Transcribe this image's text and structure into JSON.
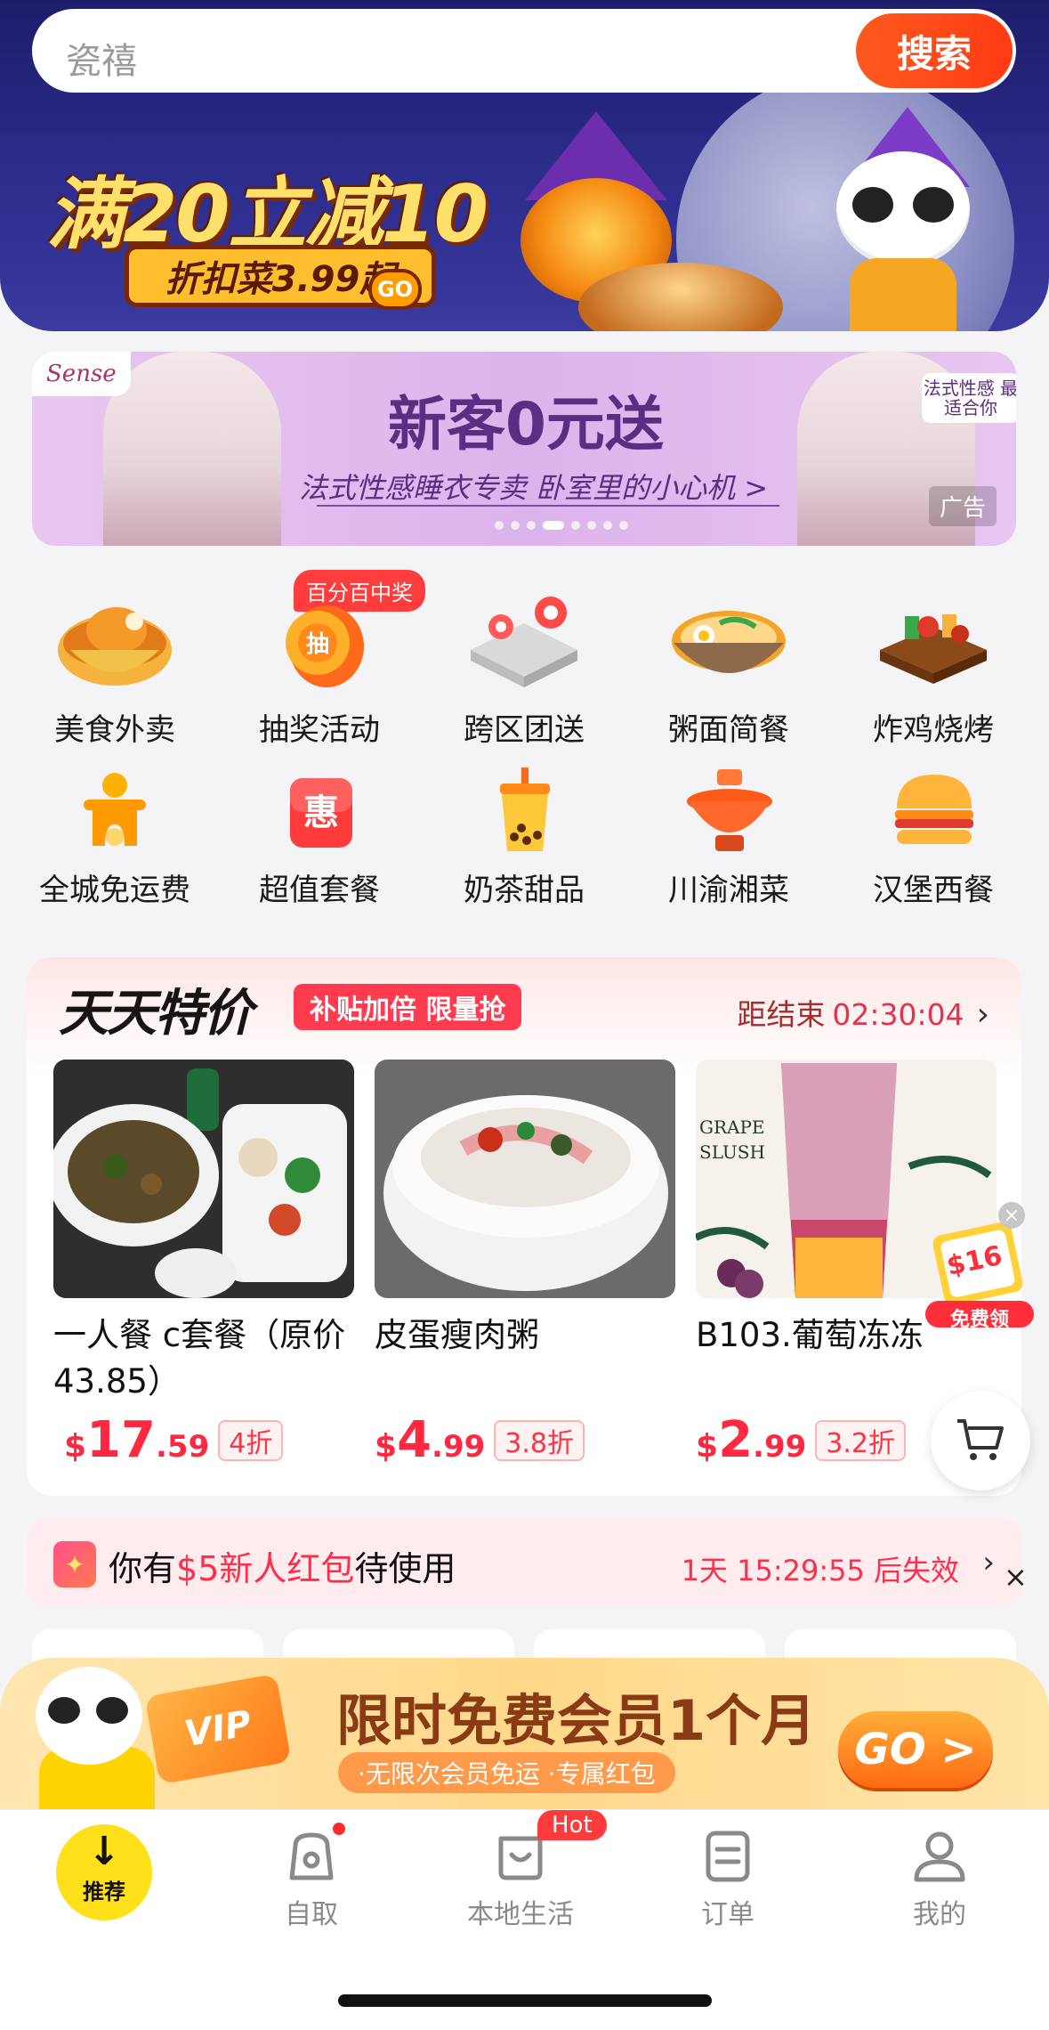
{
  "search": {
    "placeholder": "瓷禧",
    "button_label": "搜索"
  },
  "hero": {
    "headline": "满20立减10",
    "sub": "折扣菜3.99起",
    "go": "GO"
  },
  "ad_banner": {
    "brand": "Sense",
    "title": "新客0元送",
    "subtitle": "法式性感睡衣专卖 卧室里的小心机 >",
    "tag": "法式性感 最适合你",
    "label": "广告"
  },
  "categories": [
    {
      "label": "美食外卖",
      "icon": "food-bowl-icon"
    },
    {
      "label": "抽奖活动",
      "icon": "lottery-icon",
      "badge": "百分百中奖"
    },
    {
      "label": "跨区团送",
      "icon": "map-pin-icon"
    },
    {
      "label": "粥面简餐",
      "icon": "noodle-bowl-icon"
    },
    {
      "label": "炸鸡烧烤",
      "icon": "skewer-icon"
    },
    {
      "label": "全城免运费",
      "icon": "scooter-icon"
    },
    {
      "label": "超值套餐",
      "icon": "discount-icon",
      "glyph": "惠"
    },
    {
      "label": "奶茶甜品",
      "icon": "bubble-tea-icon"
    },
    {
      "label": "川渝湘菜",
      "icon": "hotpot-icon"
    },
    {
      "label": "汉堡西餐",
      "icon": "burger-icon"
    }
  ],
  "deals": {
    "title": "天天特价",
    "tag": "补贴加倍 限量抢",
    "countdown_label": "距结束",
    "countdown": "02:30:04",
    "items": [
      {
        "name": "一人餐 c套餐（原价43.85）",
        "currency": "$",
        "price_int": "17",
        "price_dec": ".59",
        "discount": "4折"
      },
      {
        "name": "皮蛋瘦肉粥",
        "currency": "$",
        "price_int": "4",
        "price_dec": ".99",
        "discount": "3.8折"
      },
      {
        "name": "B103.葡萄冻冻",
        "currency": "$",
        "price_int": "2",
        "price_dec": ".99",
        "discount": "3.2折",
        "image_text": "GRAPE SLUSH"
      }
    ],
    "coupon": {
      "amount": "$16",
      "label": "免费领"
    }
  },
  "red_packet": {
    "prefix": "你有",
    "highlight": "$5新人红包",
    "suffix": "待使用",
    "expire": "1天 15:29:55 后失效"
  },
  "vip": {
    "card": "VIP",
    "title": "限时免费会员1个月",
    "sub": "·无限次会员免运 ·专属红包",
    "go": "GO >"
  },
  "tabbar": {
    "home_label": "推荐",
    "items": [
      {
        "label": "自取"
      },
      {
        "label": "本地生活",
        "badge": "Hot"
      },
      {
        "label": "订单"
      },
      {
        "label": "我的"
      }
    ]
  },
  "colors": {
    "brand_red": "#ff2840",
    "search_orange": "#ff4a1a",
    "hero_blue": "#2a2a88",
    "tab_yellow": "#ffe01a"
  }
}
